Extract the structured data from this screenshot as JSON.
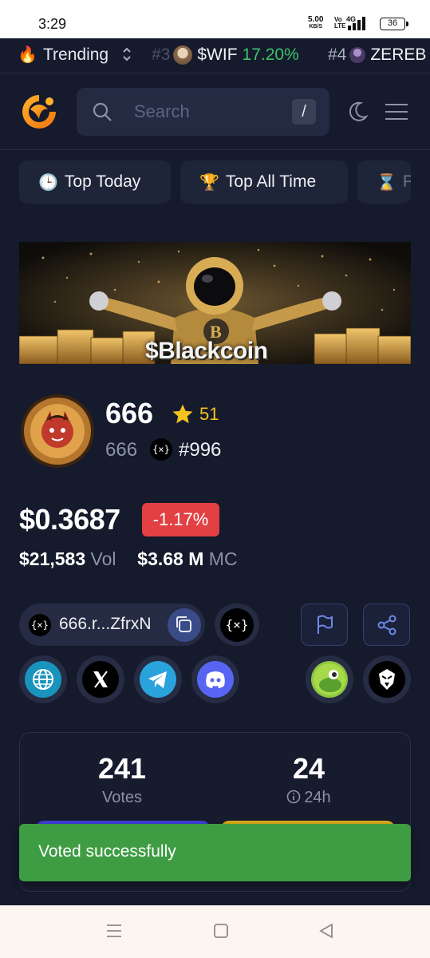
{
  "status_bar": {
    "time": "3:29",
    "net_speed": "5.00",
    "net_unit": "KB/S",
    "volte": "Vo LTE",
    "net_type": "4G",
    "battery": "36"
  },
  "ticker": {
    "label": "Trending",
    "items": [
      {
        "rank": "#3",
        "symbol": "$WIF",
        "change": "17.20%"
      },
      {
        "rank": "#4",
        "symbol": "ZEREB",
        "change": ""
      }
    ]
  },
  "header": {
    "search_placeholder": "Search",
    "search_shortcut": "/"
  },
  "tabs": [
    {
      "icon": "🕒",
      "label": "Top Today"
    },
    {
      "icon": "🏆",
      "label": "Top All Time"
    },
    {
      "icon": "⌛",
      "label": "P"
    }
  ],
  "banner": {
    "text": "$Blackcoin"
  },
  "token": {
    "name": "666",
    "stars": "51",
    "symbol": "666",
    "chain_icon": "{×}",
    "rank": "#996",
    "price": "$0.3687",
    "change": "-1.17%",
    "volume": "$21,583",
    "volume_label": "Vol",
    "market_cap": "$3.68 M",
    "market_cap_label": "MC",
    "contract": "666.r...ZfrxN"
  },
  "votes": {
    "count": "241",
    "count_label": "Votes",
    "hours": "24",
    "hours_label": "24h"
  },
  "toast": {
    "message": "Voted successfully"
  },
  "colors": {
    "positive": "#3cc36b",
    "negative": "#e24043",
    "toast": "#3e9d43",
    "star": "#f4c21d",
    "background": "#151a2c"
  }
}
